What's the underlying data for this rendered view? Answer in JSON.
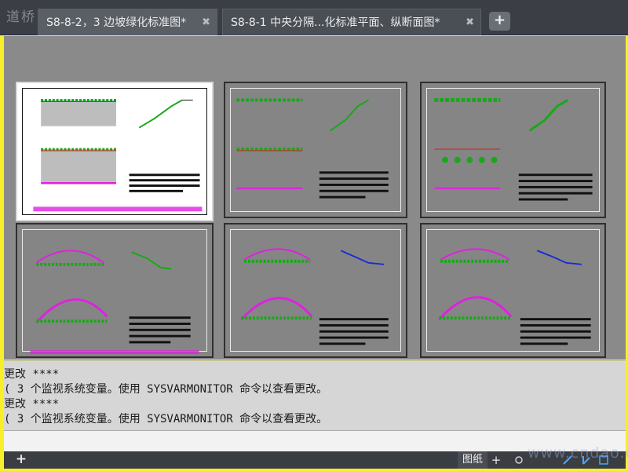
{
  "app": {
    "logo_text": "道桥"
  },
  "tabs": [
    {
      "label": "S8-8-2，3 边坡绿化标准图*",
      "active": true
    },
    {
      "label": "S8-8-1 中央分隔...化标准平面、纵断面图*",
      "active": false
    }
  ],
  "tab_close_symbol": "✖",
  "new_tab_symbol": "+",
  "layout_sheets": [
    {
      "name": "slope-greening-sheet-1",
      "selected": true
    },
    {
      "name": "slope-greening-sheet-2",
      "selected": false
    },
    {
      "name": "slope-greening-sheet-3",
      "selected": false
    },
    {
      "name": "median-greening-sheet-1",
      "selected": false
    },
    {
      "name": "median-greening-sheet-2",
      "selected": false
    },
    {
      "name": "median-greening-sheet-3",
      "selected": false
    }
  ],
  "command_history": [
    "更改 ****",
    "( 3 个监视系统变量。使用 SYSVARMONITOR 命令以查看更改。",
    "更改 ****",
    "( 3 个监视系统变量。使用 SYSVARMONITOR 命令以查看更改。"
  ],
  "statusbar": {
    "add_layout_symbol": "+",
    "paper_label": "图纸",
    "grid_symbol": "+"
  },
  "watermark": "www.cndao.com",
  "colors": {
    "accent_green": "#18a818",
    "accent_magenta": "#e020e0",
    "accent_red": "#d42020"
  }
}
